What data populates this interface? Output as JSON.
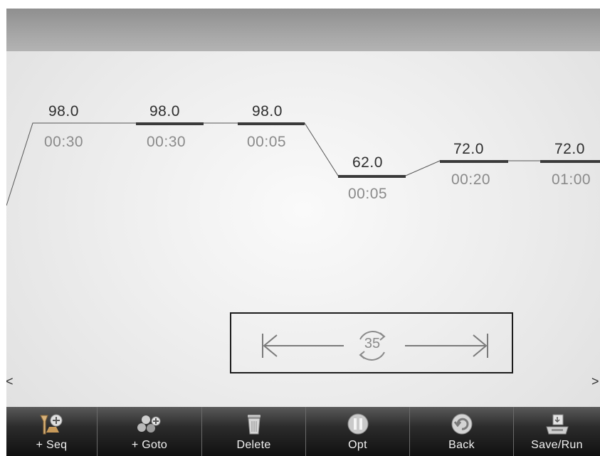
{
  "steps": [
    {
      "temp": "98.0",
      "time": "00:30"
    },
    {
      "temp": "98.0",
      "time": "00:30"
    },
    {
      "temp": "98.0",
      "time": "00:05"
    },
    {
      "temp": "62.0",
      "time": "00:05"
    },
    {
      "temp": "72.0",
      "time": "00:20"
    },
    {
      "temp": "72.0",
      "time": "01:00"
    }
  ],
  "cycle": {
    "count": "35"
  },
  "nav": {
    "prev": "<",
    "next": ">"
  },
  "toolbar": {
    "add_seq": "+ Seq",
    "add_goto": "+ Goto",
    "delete": "Delete",
    "opt": "Opt",
    "back": "Back",
    "save_run": "Save/Run"
  },
  "icons": {
    "add_seq": "flask-add-icon",
    "add_goto": "recycle-add-icon",
    "delete": "trash-icon",
    "opt": "pause-icon",
    "back": "undo-icon",
    "save_run": "computer-save-icon"
  }
}
